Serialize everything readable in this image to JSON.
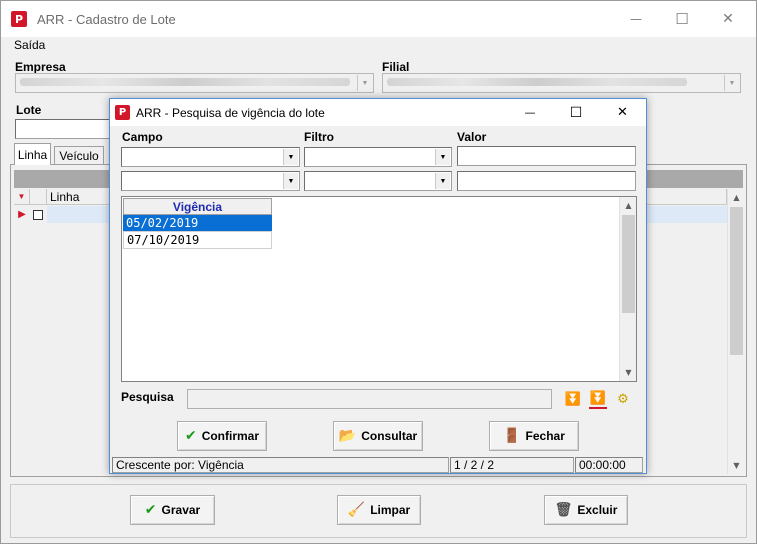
{
  "main_window": {
    "title": "ARR - Cadastro de Lote",
    "app_logo": "P",
    "controls": {
      "minimize": "—",
      "maximize": "☐",
      "close": "✕"
    },
    "menu": [
      {
        "label": "Saída"
      }
    ],
    "fields": {
      "empresa_label": "Empresa",
      "filial_label": "Filial",
      "lote_label": "Lote"
    },
    "tabs": [
      {
        "label": "Linha",
        "active": true
      },
      {
        "label": "Veículo",
        "active": false
      }
    ],
    "grid": {
      "columns": [
        "Linha"
      ]
    },
    "buttons": {
      "gravar": "Gravar",
      "limpar": "Limpar",
      "excluir": "Excluir"
    }
  },
  "dialog": {
    "title": "ARR - Pesquisa de vigência do lote",
    "app_logo": "P",
    "controls": {
      "minimize": "—",
      "maximize": "☐",
      "close": "✕"
    },
    "filter_headers": {
      "campo": "Campo",
      "filtro": "Filtro",
      "valor": "Valor"
    },
    "list": {
      "column": "Vigência",
      "rows": [
        {
          "value": "05/02/2019",
          "selected": true
        },
        {
          "value": "07/10/2019",
          "selected": false
        }
      ]
    },
    "pesquisa_label": "Pesquisa",
    "buttons": {
      "confirmar": "Confirmar",
      "consultar": "Consultar",
      "fechar": "Fechar"
    },
    "status": {
      "order": "Crescente por: Vigência",
      "record": "1 / 2 / 2",
      "time": "00:00:00"
    }
  },
  "icons": {
    "check": "check-icon",
    "broom": "broom-icon",
    "trash": "trash-icon",
    "folder": "folder-open-icon",
    "door": "door-exit-icon",
    "nav_down": "arrow-down-double-icon",
    "nav_last": "arrow-last-icon",
    "settings": "gear-icon"
  },
  "colors": {
    "selection": "#0a6fd4",
    "header_text": "#1f2bb0",
    "logo": "#d2172a",
    "check_green": "#1b9a1b",
    "row_marker": "#d2172a"
  }
}
